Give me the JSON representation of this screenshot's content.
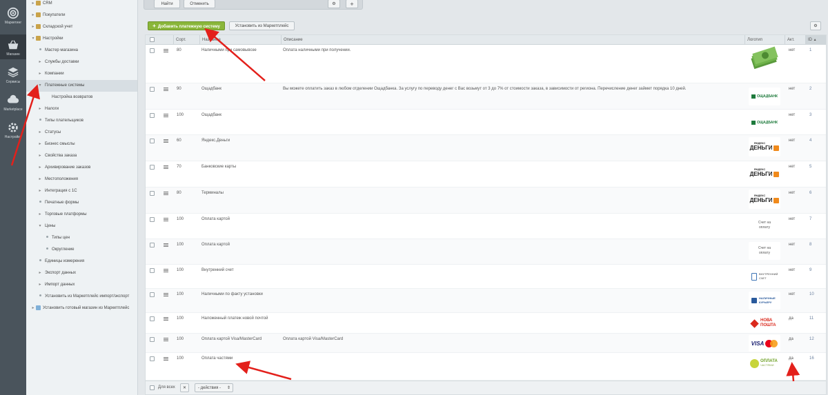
{
  "rail": [
    {
      "label": "Маркетинг",
      "icon": "target-icon"
    },
    {
      "label": "Магазин",
      "icon": "basket-icon"
    },
    {
      "label": "Сервисы",
      "icon": "layers-icon"
    },
    {
      "label": "Marketplace",
      "icon": "cloud-icon"
    },
    {
      "label": "Настройки",
      "icon": "gear-icon"
    }
  ],
  "tree": [
    {
      "label": "CRM",
      "level": 0,
      "kind": "folder"
    },
    {
      "label": "Покупатели",
      "level": 0,
      "kind": "folder"
    },
    {
      "label": "Складской учет",
      "level": 0,
      "kind": "folder"
    },
    {
      "label": "Настройки",
      "level": 0,
      "kind": "folder-open"
    },
    {
      "label": "Мастер магазина",
      "level": 1,
      "kind": "dot"
    },
    {
      "label": "Службы доставки",
      "level": 1,
      "kind": "arrow"
    },
    {
      "label": "Компании",
      "level": 1,
      "kind": "arrow"
    },
    {
      "label": "Платежные системы",
      "level": 1,
      "kind": "open",
      "selected": true
    },
    {
      "label": "Настройка возвратов",
      "level": 2,
      "kind": "none"
    },
    {
      "label": "Налоги",
      "level": 1,
      "kind": "arrow"
    },
    {
      "label": "Типы плательщиков",
      "level": 1,
      "kind": "dot"
    },
    {
      "label": "Статусы",
      "level": 1,
      "kind": "arrow"
    },
    {
      "label": "Бизнес смыслы",
      "level": 1,
      "kind": "arrow"
    },
    {
      "label": "Свойства заказа",
      "level": 1,
      "kind": "arrow"
    },
    {
      "label": "Архивирование заказов",
      "level": 1,
      "kind": "arrow"
    },
    {
      "label": "Местоположения",
      "level": 1,
      "kind": "arrow"
    },
    {
      "label": "Интеграция с 1С",
      "level": 1,
      "kind": "arrow"
    },
    {
      "label": "Печатные формы",
      "level": 1,
      "kind": "dot"
    },
    {
      "label": "Торговые платформы",
      "level": 1,
      "kind": "arrow"
    },
    {
      "label": "Цены",
      "level": 1,
      "kind": "open"
    },
    {
      "label": "Типы цен",
      "level": 2,
      "kind": "dot"
    },
    {
      "label": "Округление",
      "level": 2,
      "kind": "dot"
    },
    {
      "label": "Единицы измерения",
      "level": 1,
      "kind": "dot"
    },
    {
      "label": "Экспорт данных",
      "level": 1,
      "kind": "arrow"
    },
    {
      "label": "Импорт данных",
      "level": 1,
      "kind": "arrow"
    },
    {
      "label": "Установить из Маркетплейс импорт/экспорт",
      "level": 1,
      "kind": "dot"
    },
    {
      "label": "Установить готовый магазин из Маркетплейс",
      "level": 0,
      "kind": "shop"
    }
  ],
  "filter": {
    "find": "Найти",
    "cancel": "Отменить"
  },
  "toolbar": {
    "add": "Добавить платежную систему",
    "install": "Установить из Маркетплейс"
  },
  "columns": {
    "sort": "Сорт.",
    "name": "Название",
    "description": "Описание",
    "logo": "Логотип",
    "active": "Акт.",
    "id": "ID"
  },
  "rows": [
    {
      "sort": "80",
      "name": "Наличными при самовывозе",
      "description": "Оплата наличными при получении.",
      "logo": "cash",
      "active": "нет",
      "id": "1"
    },
    {
      "sort": "90",
      "name": "Ощадбанк",
      "description": "Вы можете оплатить заказ в любом отделении Ощадбанка. За услугу по переводу денег с Вас возьмут от 3 до 7% от стоимости заказа, в зависимости от региона. Перечисление денег займет порядка 10 дней.",
      "logo": "oschad",
      "logo_text": "ОЩАДБАНК",
      "active": "нет",
      "id": "2"
    },
    {
      "sort": "100",
      "name": "Ощадбанк",
      "description": "",
      "logo": "oschad",
      "logo_text": "ОЩАДБАНК",
      "active": "нет",
      "id": "3"
    },
    {
      "sort": "60",
      "name": "Яндекс.Деньги",
      "description": "",
      "logo": "yandex",
      "logo_text": "ДЕНЬГИ",
      "logo_sub": "ЯНДЕКС",
      "active": "нет",
      "id": "4"
    },
    {
      "sort": "70",
      "name": "Банковские карты",
      "description": "",
      "logo": "yandex",
      "logo_text": "ДЕНЬГИ",
      "logo_sub": "ЯНДЕКС",
      "active": "нет",
      "id": "5"
    },
    {
      "sort": "80",
      "name": "Терминалы",
      "description": "",
      "logo": "yandex",
      "logo_text": "ДЕНЬГИ",
      "logo_sub": "ЯНДЕКС",
      "active": "нет",
      "id": "6"
    },
    {
      "sort": "100",
      "name": "Оплата картой",
      "description": "",
      "logo": "bill",
      "logo_text": "Счет на оплату",
      "active": "нет",
      "id": "7"
    },
    {
      "sort": "100",
      "name": "Оплата картой",
      "description": "",
      "logo": "bill",
      "logo_text": "Счет на оплату",
      "active": "нет",
      "id": "8"
    },
    {
      "sort": "100",
      "name": "Внутренний счет",
      "description": "",
      "logo": "internal",
      "logo_text": "ВНУТРЕННИЙ СЧЕТ",
      "active": "нет",
      "id": "9"
    },
    {
      "sort": "100",
      "name": "Наличными по факту установки",
      "description": "",
      "logo": "courier",
      "logo_text": "НАЛИЧНЫЕ КУРЬЕРУ",
      "active": "нет",
      "id": "10"
    },
    {
      "sort": "100",
      "name": "Наложенный платеж новой почтой",
      "description": "",
      "logo": "novapost",
      "logo_text": "НОВА ПОШТА",
      "active": "да",
      "id": "11"
    },
    {
      "sort": "100",
      "name": "Оплата картой Visa/MasterCard",
      "description": "Оплата картой Visa/MasterCard",
      "logo": "visa",
      "logo_text": "VISA",
      "active": "да",
      "id": "12"
    },
    {
      "sort": "100",
      "name": "Оплата частями",
      "description": "",
      "logo": "parts",
      "logo_text": "ОПЛАТА",
      "logo_sub": "ЧАСТЯМИ",
      "active": "да",
      "id": "16"
    }
  ],
  "footer": {
    "for_all": "Для всех",
    "actions": "- действия -"
  },
  "colors": {
    "accent_green": "#8ab63a",
    "arrow_red": "#e3201b",
    "rail_bg": "#4a545c"
  }
}
